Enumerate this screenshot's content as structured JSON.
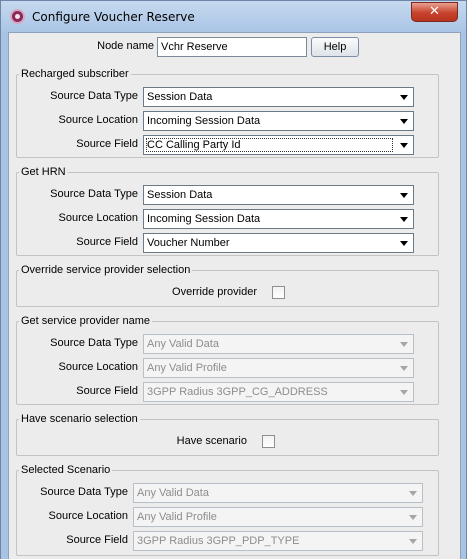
{
  "window": {
    "title": "Configure Voucher Reserve",
    "close_glyph": "✕",
    "icon": "app-logo-icon"
  },
  "node": {
    "label": "Node name",
    "value": "Vchr Reserve",
    "help_label": "Help"
  },
  "labels": {
    "source_data_type": "Source Data Type",
    "source_location": "Source Location",
    "source_field": "Source Field"
  },
  "recharged": {
    "title": "Recharged subscriber",
    "data_type": "Session Data",
    "location": "Incoming Session Data",
    "field": "CC Calling Party Id"
  },
  "hrn": {
    "title": "Get HRN",
    "data_type": "Session Data",
    "location": "Incoming Session Data",
    "field": "Voucher Number"
  },
  "override": {
    "title": "Override service provider selection",
    "label": "Override provider",
    "checked": false
  },
  "sp_name": {
    "title": "Get service provider name",
    "data_type": "Any Valid Data",
    "location": "Any Valid Profile",
    "field": "3GPP Radius 3GPP_CG_ADDRESS"
  },
  "scenario": {
    "title": "Have scenario selection",
    "label": "Have scenario",
    "checked": false
  },
  "selected": {
    "title": "Selected Scenario",
    "data_type": "Any Valid Data",
    "location": "Any Valid Profile",
    "field": "3GPP Radius 3GPP_PDP_TYPE"
  },
  "colors": {
    "frame": "#a9c3e2",
    "panel": "#ececec",
    "close": "#c7422c"
  }
}
